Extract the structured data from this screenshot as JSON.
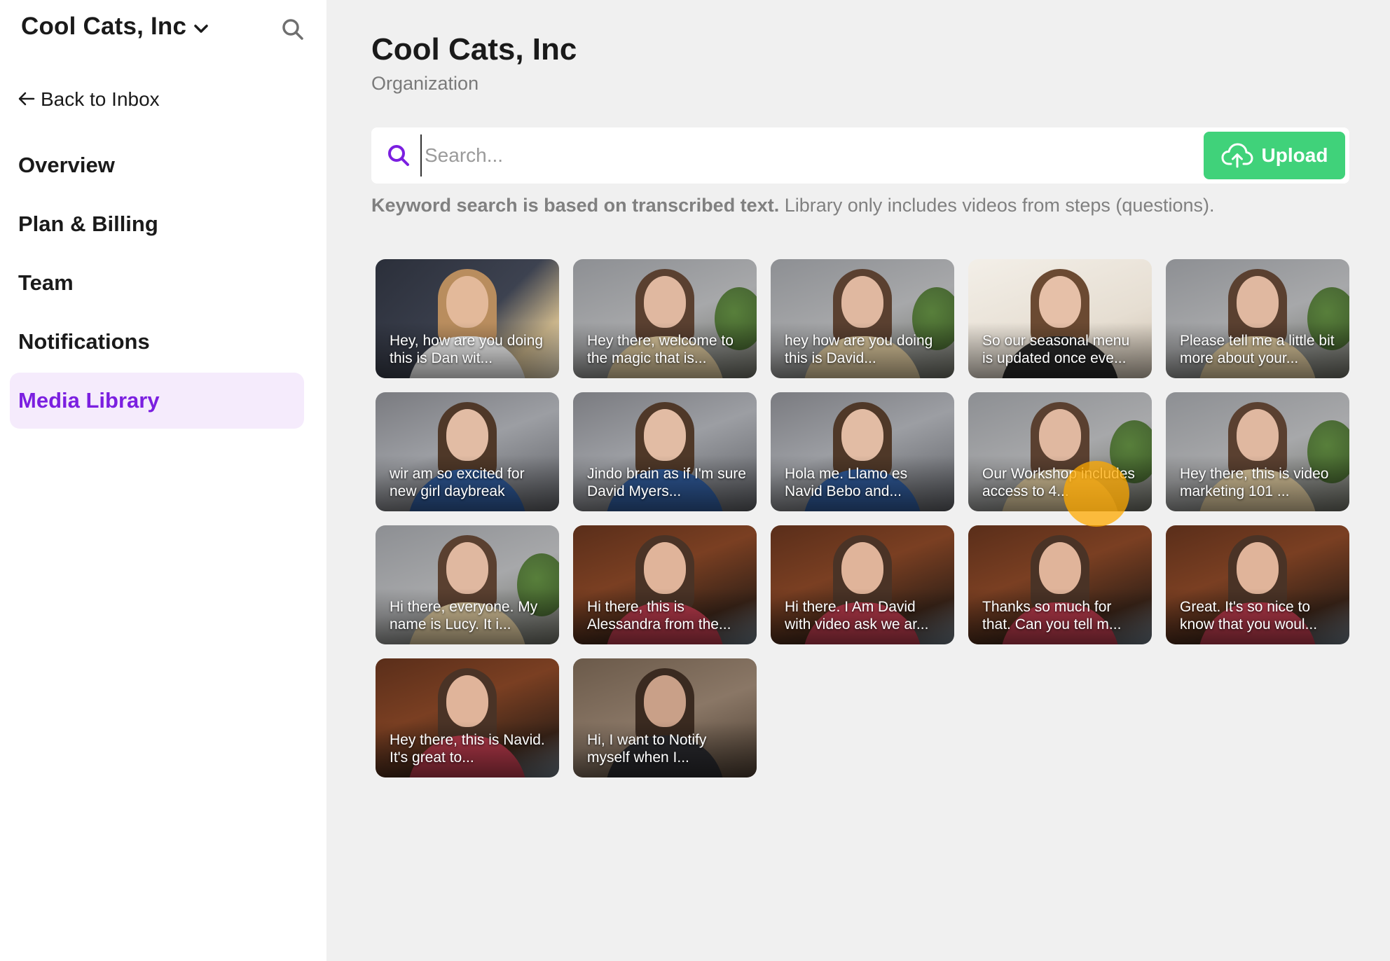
{
  "sidebar": {
    "org_name": "Cool Cats, Inc",
    "back_label": "Back to Inbox",
    "nav": [
      {
        "label": "Overview",
        "active": false
      },
      {
        "label": "Plan & Billing",
        "active": false
      },
      {
        "label": "Team",
        "active": false
      },
      {
        "label": "Notifications",
        "active": false
      },
      {
        "label": "Media Library",
        "active": true
      }
    ],
    "icons": {
      "org_switch": "chevron-down-icon",
      "search": "search-icon",
      "back": "arrow-left-icon"
    }
  },
  "main": {
    "title": "Cool Cats, Inc",
    "subtitle": "Organization",
    "search": {
      "placeholder": "Search...",
      "value": ""
    },
    "upload_label": "Upload",
    "hint_bold": "Keyword search is based on transcribed text.",
    "hint_rest": " Library only includes videos from steps (questions).",
    "videos": [
      {
        "caption": "Hey, how are you doing this is Dan wit...",
        "scene": "dark-office"
      },
      {
        "caption": "Hey there, welcome to the magic that is...",
        "scene": "plant"
      },
      {
        "caption": "hey how are you doing this is David...",
        "scene": "plant"
      },
      {
        "caption": "So our seasonal menu is updated once eve...",
        "scene": "white-wall"
      },
      {
        "caption": "Please tell me a little bit more about your...",
        "scene": "plant"
      },
      {
        "caption": "wir am so excited for new girl daybreak",
        "scene": "grey-room"
      },
      {
        "caption": "Jindo brain as if I'm sure David Myers...",
        "scene": "grey-room"
      },
      {
        "caption": "Hola me. Llamo es Navid Bebo and...",
        "scene": "grey-room"
      },
      {
        "caption": "Our Workshop includes access to 4...",
        "scene": "plant"
      },
      {
        "caption": "Hey there, this is video marketing 101 ...",
        "scene": "plant"
      },
      {
        "caption": "Hi there, everyone. My name is Lucy. It i...",
        "scene": "plant"
      },
      {
        "caption": "Hi there, this is Alessandra from the...",
        "scene": "wood-room"
      },
      {
        "caption": "Hi there. I Am David with video ask we ar...",
        "scene": "wood-room"
      },
      {
        "caption": "Thanks so much for that. Can you tell m...",
        "scene": "wood-room"
      },
      {
        "caption": "Great. It's so nice to know that you woul...",
        "scene": "wood-room"
      },
      {
        "caption": "Hey there, this is Navid. It's great to...",
        "scene": "wood-room"
      },
      {
        "caption": "Hi, I want to Notify myself when I...",
        "scene": "dim-room"
      }
    ]
  },
  "colors": {
    "accent": "#7b1fe0",
    "accent_bg": "#f5ebfc",
    "upload": "#40d27a",
    "page_bg": "#f0f0f0"
  }
}
